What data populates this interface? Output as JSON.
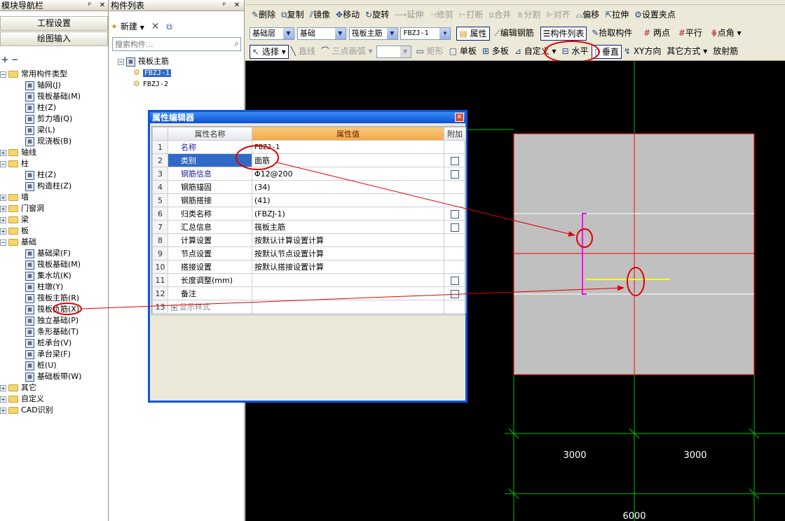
{
  "nav_panel": {
    "title": "模块导航栏",
    "pin": "ᵖ",
    "close": "✕",
    "buttons": [
      "工程设置",
      "绘图输入"
    ],
    "tree": [
      {
        "label": "常用构件类型",
        "type": "folder",
        "expanded": true,
        "level": 0
      },
      {
        "label": "轴网(J)",
        "level": 1
      },
      {
        "label": "筏板基础(M)",
        "level": 1
      },
      {
        "label": "柱(Z)",
        "level": 1
      },
      {
        "label": "剪力墙(Q)",
        "level": 1
      },
      {
        "label": "梁(L)",
        "level": 1
      },
      {
        "label": "现浇板(B)",
        "level": 1
      },
      {
        "label": "轴线",
        "type": "folder",
        "expanded": false,
        "level": 0
      },
      {
        "label": "柱",
        "type": "folder",
        "expanded": true,
        "level": 0
      },
      {
        "label": "柱(Z)",
        "level": 1
      },
      {
        "label": "构造柱(Z)",
        "level": 1
      },
      {
        "label": "墙",
        "type": "folder",
        "expanded": false,
        "level": 0
      },
      {
        "label": "门窗洞",
        "type": "folder",
        "expanded": false,
        "level": 0
      },
      {
        "label": "梁",
        "type": "folder",
        "expanded": false,
        "level": 0
      },
      {
        "label": "板",
        "type": "folder",
        "expanded": false,
        "level": 0
      },
      {
        "label": "基础",
        "type": "folder",
        "expanded": true,
        "level": 0
      },
      {
        "label": "基础梁(F)",
        "level": 1
      },
      {
        "label": "筏板基础(M)",
        "level": 1
      },
      {
        "label": "集水坑(K)",
        "level": 1
      },
      {
        "label": "柱墩(Y)",
        "level": 1
      },
      {
        "label": "筏板主筋(R)",
        "level": 1
      },
      {
        "label": "筏板负筋(X)",
        "level": 1
      },
      {
        "label": "独立基础(P)",
        "level": 1
      },
      {
        "label": "条形基础(T)",
        "level": 1
      },
      {
        "label": "桩承台(V)",
        "level": 1
      },
      {
        "label": "承台梁(F)",
        "level": 1
      },
      {
        "label": "桩(U)",
        "level": 1
      },
      {
        "label": "基础板带(W)",
        "level": 1
      },
      {
        "label": "其它",
        "type": "folder",
        "expanded": false,
        "level": 0
      },
      {
        "label": "自定义",
        "type": "folder",
        "expanded": false,
        "level": 0
      },
      {
        "label": "CAD识别",
        "type": "folder",
        "expanded": false,
        "level": 0
      }
    ]
  },
  "component_panel": {
    "title": "构件列表",
    "new_label": "新建",
    "search_placeholder": "搜索构件...",
    "root": "筏板主筋",
    "items": [
      "FBZJ-1",
      "FBZJ-2"
    ]
  },
  "toolbar1": [
    "删除",
    "复制",
    "镜像",
    "移动",
    "旋转",
    "延伸",
    "修剪",
    "打断",
    "合并",
    "分割",
    "对齐",
    "偏移",
    "拉伸",
    "设置夹点"
  ],
  "toolbar2": {
    "floor": "基础层",
    "category": "基础",
    "type": "筏板主筋",
    "component": "FBZJ-1",
    "buttons": [
      "属性",
      "编辑钢筋",
      "构件列表",
      "拾取构件",
      "两点",
      "平行",
      "点角"
    ]
  },
  "toolbar3": [
    "选择",
    "直线",
    "三点画弧",
    "矩形",
    "单板",
    "多板",
    "自定义",
    "水平",
    "垂直",
    "XY方向",
    "其它方式",
    "放射筋"
  ],
  "dialog": {
    "title": "属性编辑器",
    "headers": [
      "属性名称",
      "属性值",
      "附加"
    ],
    "rows": [
      {
        "num": "1",
        "name": "名称",
        "value": "FBZJ-1",
        "check": false,
        "blue": true
      },
      {
        "num": "2",
        "name": "类别",
        "value": "面筋",
        "check": true,
        "blue": false,
        "selected": true
      },
      {
        "num": "3",
        "name": "钢筋信息",
        "value": "Φ12@200",
        "check": true,
        "blue": true
      },
      {
        "num": "4",
        "name": "钢筋锚固",
        "value": "(34)",
        "check": false,
        "blue": false
      },
      {
        "num": "5",
        "name": "钢筋搭接",
        "value": "(41)",
        "check": false,
        "blue": false
      },
      {
        "num": "6",
        "name": "归类名称",
        "value": "(FBZJ-1)",
        "check": true,
        "blue": false
      },
      {
        "num": "7",
        "name": "汇总信息",
        "value": "筏板主筋",
        "check": true,
        "blue": false
      },
      {
        "num": "8",
        "name": "计算设置",
        "value": "按默认计算设置计算",
        "check": false,
        "blue": false
      },
      {
        "num": "9",
        "name": "节点设置",
        "value": "按默认节点设置计算",
        "check": false,
        "blue": false
      },
      {
        "num": "10",
        "name": "搭接设置",
        "value": "按默认搭接设置计算",
        "check": false,
        "blue": false
      },
      {
        "num": "11",
        "name": "长度调整(mm)",
        "value": "",
        "check": true,
        "blue": false
      },
      {
        "num": "12",
        "name": "备注",
        "value": "",
        "check": true,
        "blue": false
      },
      {
        "num": "13",
        "name": "显示样式",
        "value": "",
        "check": false,
        "blue": false,
        "group": true
      }
    ]
  },
  "canvas": {
    "dims": [
      "3000",
      "3000",
      "6000"
    ]
  }
}
